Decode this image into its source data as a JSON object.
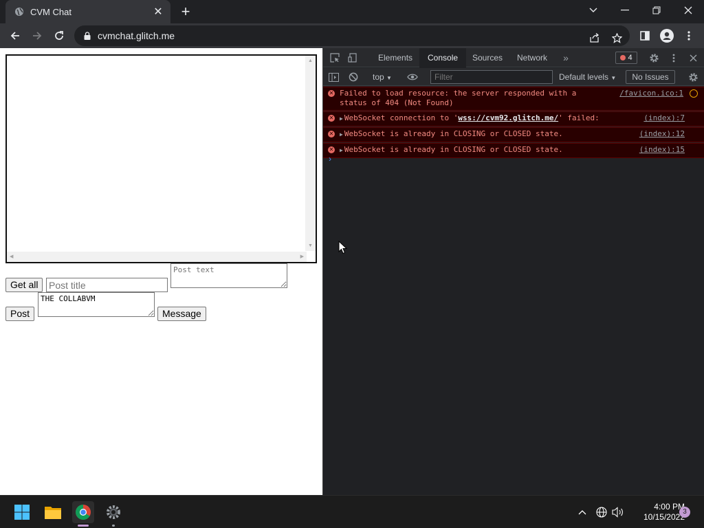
{
  "browser": {
    "tab_title": "CVM Chat",
    "url": "cvmchat.glitch.me"
  },
  "page": {
    "get_all_label": "Get all",
    "post_title_placeholder": "Post title",
    "post_text_placeholder": "Post text",
    "post_label": "Post",
    "message_value": "THE COLLABVM",
    "message_label": "Message"
  },
  "devtools": {
    "tabs": [
      "Elements",
      "Console",
      "Sources",
      "Network"
    ],
    "error_count": "4",
    "context": "top",
    "filter_placeholder": "Filter",
    "levels": "Default levels",
    "issues": "No Issues",
    "messages": [
      {
        "pre": "Failed to load resource: the server responded with a status of 404 (Not Found)",
        "link": "",
        "post": "",
        "source": "/favicon.ico:1",
        "expandable": false
      },
      {
        "pre": "WebSocket connection to '",
        "link": "wss://cvm92.glitch.me/",
        "post": "' failed:",
        "source": "(index):7",
        "expandable": true
      },
      {
        "pre": "WebSocket is already in CLOSING or CLOSED state.",
        "link": "",
        "post": "",
        "source": "(index):12",
        "expandable": true
      },
      {
        "pre": "WebSocket is already in CLOSING or CLOSED state.",
        "link": "",
        "post": "",
        "source": "(index):15",
        "expandable": true
      }
    ]
  },
  "taskbar": {
    "time": "4:00 PM",
    "date": "10/15/2022",
    "notifications": "3"
  },
  "colors": {
    "error_text": "#f28b82",
    "error_bg": "#290000",
    "accent": "#4d90fe"
  }
}
